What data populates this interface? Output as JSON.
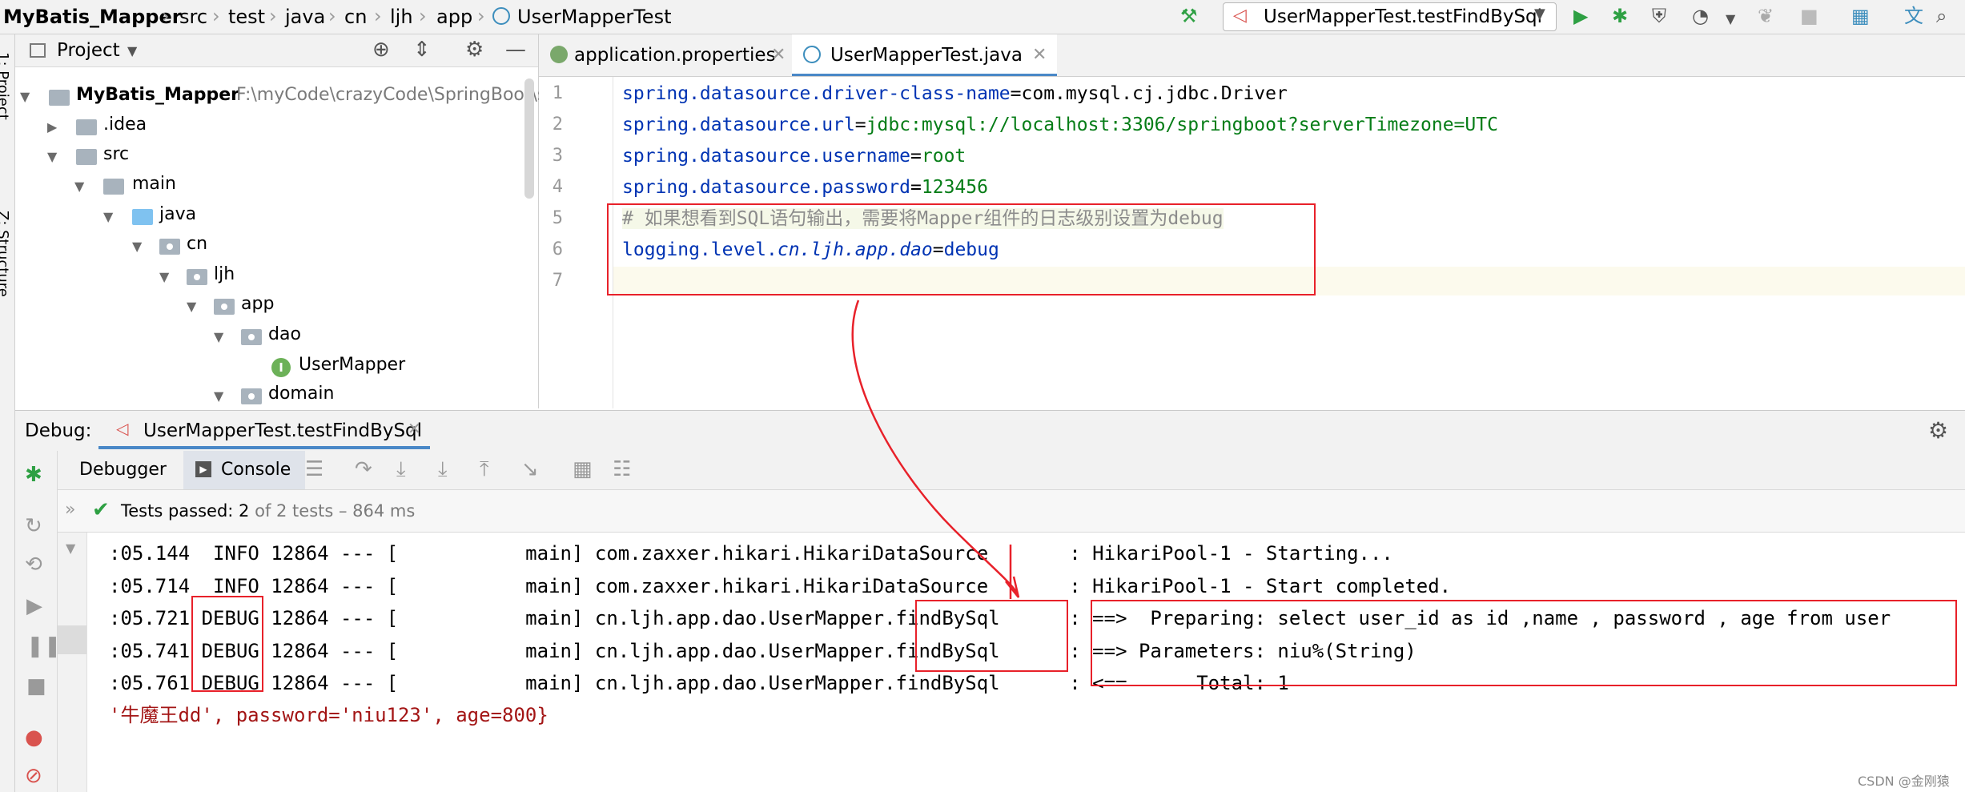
{
  "breadcrumb": [
    "MyBatis_Mapper",
    "src",
    "test",
    "java",
    "cn",
    "ljh",
    "app",
    "UserMapperTest"
  ],
  "run_config": "UserMapperTest.testFindBySql",
  "side_strip": {
    "project": "1: Project",
    "structure": "Z: Structure"
  },
  "project_panel": {
    "title": "Project",
    "tree": [
      {
        "label": "MyBatis_Mapper",
        "path": "F:\\myCode\\crazyCode\\SpringBoot\\s",
        "bold": true
      },
      {
        "label": ".idea"
      },
      {
        "label": "src"
      },
      {
        "label": "main"
      },
      {
        "label": "java"
      },
      {
        "label": "cn"
      },
      {
        "label": "ljh"
      },
      {
        "label": "app"
      },
      {
        "label": "dao"
      },
      {
        "label": "UserMapper",
        "badge": "I"
      },
      {
        "label": "domain"
      }
    ]
  },
  "editor_tabs": [
    {
      "label": "application.properties",
      "active": false
    },
    {
      "label": "UserMapperTest.java",
      "active": true
    }
  ],
  "line_numbers": [
    "1",
    "2",
    "3",
    "4",
    "5",
    "6",
    "7"
  ],
  "code": {
    "l1_key": "spring.datasource.driver-class-name",
    "l1_eq": "=",
    "l1_val": "com.mysql.cj.jdbc.Driver",
    "l2_key": "spring.datasource.url",
    "l2_eq": "=",
    "l2_val": "jdbc:mysql://localhost:3306/springboot?serverTimezone=UTC",
    "l3_key": "spring.datasource.username",
    "l3_eq": "=",
    "l3_val": "root",
    "l4_key": "spring.datasource.password",
    "l4_eq": "=",
    "l4_val": "123456",
    "l5_comment": "# 如果想看到SQL语句输出，需要将Mapper组件的日志级别设置为debug",
    "l6_prefix": "logging.level.",
    "l6_pkg": "cn.ljh.app.dao",
    "l6_eq": "=",
    "l6_val": "debug"
  },
  "debug": {
    "label": "Debug:",
    "session": "UserMapperTest.testFindBySql",
    "tabs": [
      "Debugger",
      "Console"
    ],
    "tests_status_strong": "Tests passed: 2",
    "tests_status_rest": " of 2 tests – 864 ms"
  },
  "console_lines": [
    ":05.144  INFO 12864 --- [           main] com.zaxxer.hikari.HikariDataSource       : HikariPool-1 - Starting...",
    ":05.714  INFO 12864 --- [           main] com.zaxxer.hikari.HikariDataSource       : HikariPool-1 - Start completed.",
    ":05.721 DEBUG 12864 --- [           main] cn.ljh.app.dao.UserMapper.findBySql      : ==>  Preparing: select user_id as id ,name , password , age from user",
    ":05.741 DEBUG 12864 --- [           main] cn.ljh.app.dao.UserMapper.findBySql      : ==> Parameters: niu%(String)",
    ":05.761 DEBUG 12864 --- [           main] cn.ljh.app.dao.UserMapper.findBySql      : <==      Total: 1"
  ],
  "console_result": "'牛魔王dd', password='niu123', age=800}",
  "watermark": "CSDN @金刚猿",
  "colors": {
    "annotation": "#e8212a",
    "key": "#0033b3",
    "value": "#067d17",
    "comment": "#8c8c8c"
  }
}
